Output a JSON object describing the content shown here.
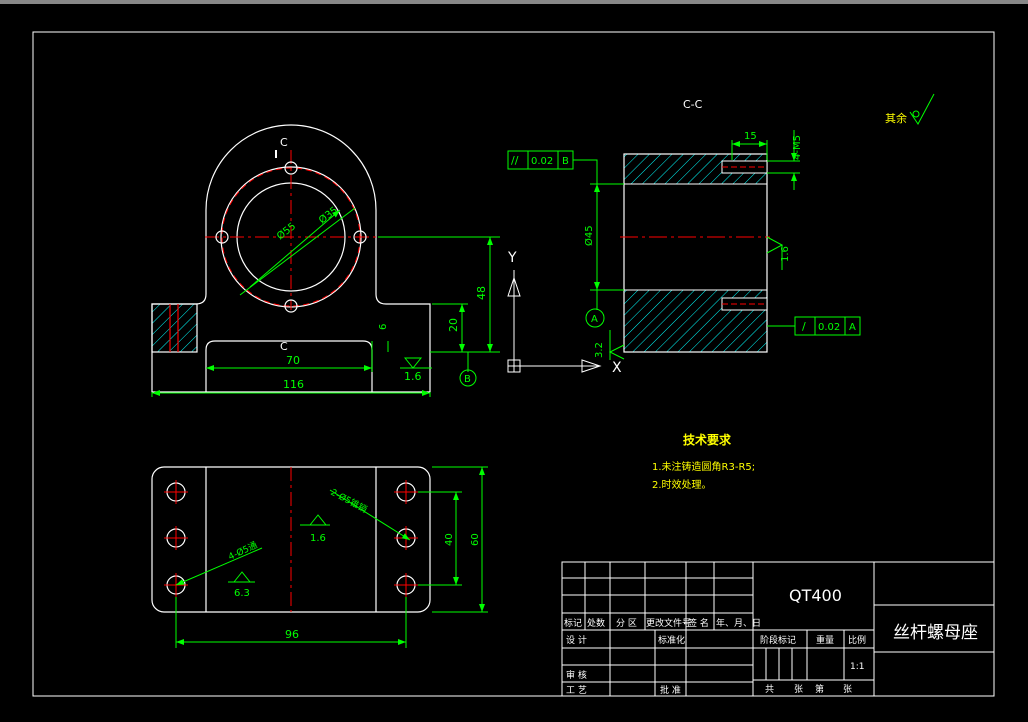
{
  "colors": {
    "background": "#000000",
    "outline": "#ffffff",
    "dimension": "#00ff00",
    "centerline": "#ff0000",
    "hatch": "#00ffff",
    "text": "#ffff00"
  },
  "front_view": {
    "section_mark_top": "C",
    "section_mark_bottom": "C",
    "dim_outer_dia": "Ø55",
    "dim_pcd": "Ø35",
    "dim_total_width": "116",
    "dim_slot_width": "70",
    "dim_base_height": "6",
    "dim_step_height": "20",
    "dim_center_height": "48",
    "roughness_bottom": "1.6",
    "datum_bottom": "B"
  },
  "section_view": {
    "title": "C-C",
    "fcf_top": {
      "symbol": "//",
      "tolerance": "0.02",
      "datum": "B"
    },
    "fcf_bottom": {
      "symbol": "/",
      "tolerance": "0.02",
      "datum": "A"
    },
    "dim_bore": "Ø45",
    "dim_thread_depth": "15",
    "dim_thread": "4-M5",
    "roughness_bore": "1.6",
    "roughness_side": "3.2",
    "datum_bore": "A"
  },
  "axes": {
    "y_label": "Y",
    "x_label": "X"
  },
  "surface_finish_note": {
    "label": "其余"
  },
  "top_view": {
    "hole_callout_right": "2-Ø5锥销",
    "hole_callout_left": "4-Ø5通",
    "roughness_center": "1.6",
    "roughness_left": "6.3",
    "dim_hole_span": "96",
    "dim_hole_pitch": "40",
    "dim_depth": "60"
  },
  "tech_requirements": {
    "heading": "技术要求",
    "items": [
      "1.未注铸造圆角R3-R5;",
      "2.时效处理。"
    ]
  },
  "title_block": {
    "material": "QT400",
    "part_name": "丝杆螺母座",
    "rev_headers": [
      "标记",
      "处数",
      "分 区",
      "更改文件号",
      "签 名",
      "年、月、日"
    ],
    "row_design": "设 计",
    "row_standard": "标准化",
    "row_check": "审 核",
    "row_process": "工 艺",
    "row_approve": "批 准",
    "stage_mark": "阶段标记",
    "weight": "重量",
    "scale": "比例",
    "scale_value": "1:1",
    "sheets_total": "共",
    "sheets_label": "张",
    "sheet_no": "第",
    "sheet_label": "张"
  }
}
